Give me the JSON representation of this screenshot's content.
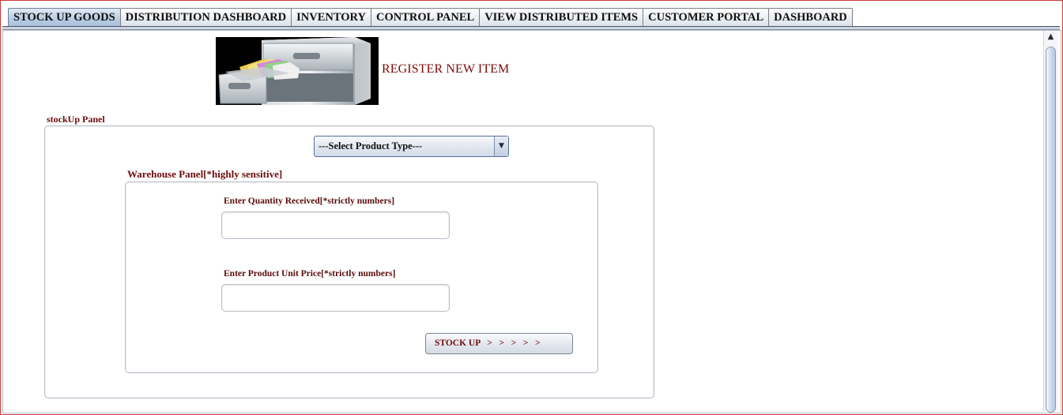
{
  "tabs": [
    {
      "label": "STOCK UP GOODS",
      "active": true
    },
    {
      "label": "DISTRIBUTION DASHBOARD",
      "active": false
    },
    {
      "label": "INVENTORY",
      "active": false
    },
    {
      "label": "CONTROL PANEL",
      "active": false
    },
    {
      "label": "VIEW DISTRIBUTED ITEMS",
      "active": false
    },
    {
      "label": "CUSTOMER PORTAL",
      "active": false
    },
    {
      "label": "DASHBOARD",
      "active": false
    }
  ],
  "header": {
    "image_icon": "filing-cabinet-icon",
    "title": "REGISTER NEW ITEM"
  },
  "stockup_panel": {
    "title": "stockUp Panel",
    "product_type_select": {
      "selected": "---Select Product Type---",
      "arrow_icon": "dropdown-arrow-icon"
    }
  },
  "warehouse_panel": {
    "title": "Warehouse Panel[*highly sensitive]",
    "quantity": {
      "label": "Enter Quantity Received[*strictly numbers]",
      "value": ""
    },
    "unit_price": {
      "label": "Enter Product Unit Price[*strictly numbers]",
      "value": ""
    },
    "stock_up_button": "STOCK UP   >   >   >   >   >"
  },
  "colors": {
    "label_text": "#6b0c0c",
    "active_tab": "#b6cbe2",
    "frame_border": "#cc3a3a"
  }
}
